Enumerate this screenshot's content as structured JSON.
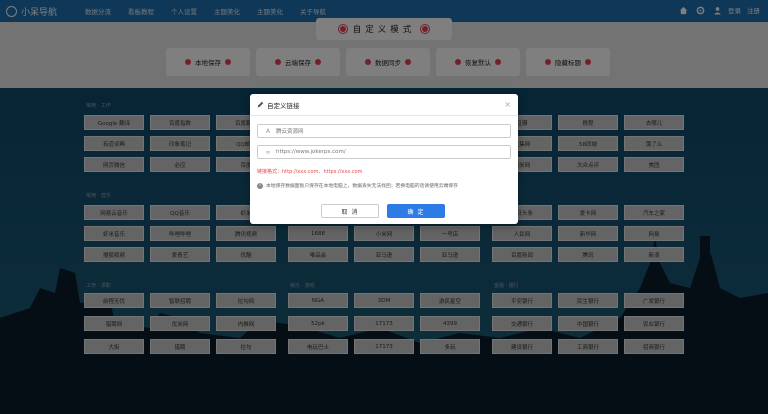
{
  "navbar": {
    "logo": "小呆导航",
    "menu": [
      "数据分流",
      "看板教程",
      "个人设置",
      "主题美化",
      "主题美化",
      "关于导航"
    ],
    "login": "登录",
    "register": "注册"
  },
  "mode_title": "自定义模式",
  "actions": [
    "本地保存",
    "云端保存",
    "数据同步",
    "恢复默认",
    "隐藏标题"
  ],
  "groups": [
    {
      "title": "常用 · 工作",
      "rows": [
        [
          "Google 翻译",
          "百度指数",
          "百度翻译"
        ],
        [
          "有道词典",
          "印象笔记",
          "QQ邮箱"
        ],
        [
          "网页微信",
          "必应",
          "百度"
        ]
      ]
    },
    {
      "title": "常用 · 音乐",
      "rows": [
        [
          "网易云音乐",
          "QQ音乐",
          "虾米"
        ],
        [
          "虾米音乐",
          "哔哩哔哩",
          "腾讯视频"
        ],
        [
          "搜狐视频",
          "爱奇艺",
          "优酷"
        ]
      ]
    },
    {
      "title": "工作 · 求职",
      "rows": [
        [
          "前程无忧",
          "智联招聘",
          "拉勾网"
        ],
        [
          "猎聘网",
          "优米网",
          "内推网"
        ],
        [
          "大街",
          "猎聘",
          "拉勾"
        ]
      ]
    },
    {
      "title": "",
      "rows": [
        [
          "",
          "",
          ""
        ],
        [
          "1688",
          "小米网",
          "一号店"
        ],
        [
          "唯品会",
          "亚马逊",
          "亚马逊"
        ]
      ]
    },
    {
      "title": "娱乐 · 游戏",
      "rows": [
        [
          "NGA",
          "3DM",
          "游民星空"
        ],
        [
          "52pk",
          "17173",
          "4399"
        ],
        [
          "电玩巴士",
          "17173",
          "多玩"
        ]
      ]
    },
    {
      "title": "",
      "rows": [
        [
          "豆瓣",
          "携程",
          "去哪儿"
        ],
        [
          "赶集网",
          "58同城",
          "饿了么"
        ],
        [
          "糯米网",
          "大众点评",
          "美团"
        ]
      ]
    },
    {
      "title": "",
      "rows": [
        [
          "今日头条",
          "爱卡网",
          "汽车之家"
        ],
        [
          "人民网",
          "新华网",
          "网易"
        ],
        [
          "百度新闻",
          "腾讯",
          "新浪"
        ]
      ]
    },
    {
      "title": "金融 · 银行",
      "rows": [
        [
          "平安银行",
          "民生银行",
          "广发银行"
        ],
        [
          "交通银行",
          "中国银行",
          "农业银行"
        ],
        [
          "建设银行",
          "工商银行",
          "招商银行"
        ]
      ]
    }
  ],
  "modal": {
    "title": "自定义链接",
    "close": "×",
    "name_placeholder": "腾云资源网",
    "url_placeholder": "https://www.jokerps.com/",
    "format_hint": "链接格式：http://xxx.com、https://xxx.com",
    "note": "本地保存数据面板只保存在本地电脑上，数据丢失无法找回；若换电脑的话请使用云端保存",
    "cancel": "取 消",
    "ok": "确 定"
  }
}
